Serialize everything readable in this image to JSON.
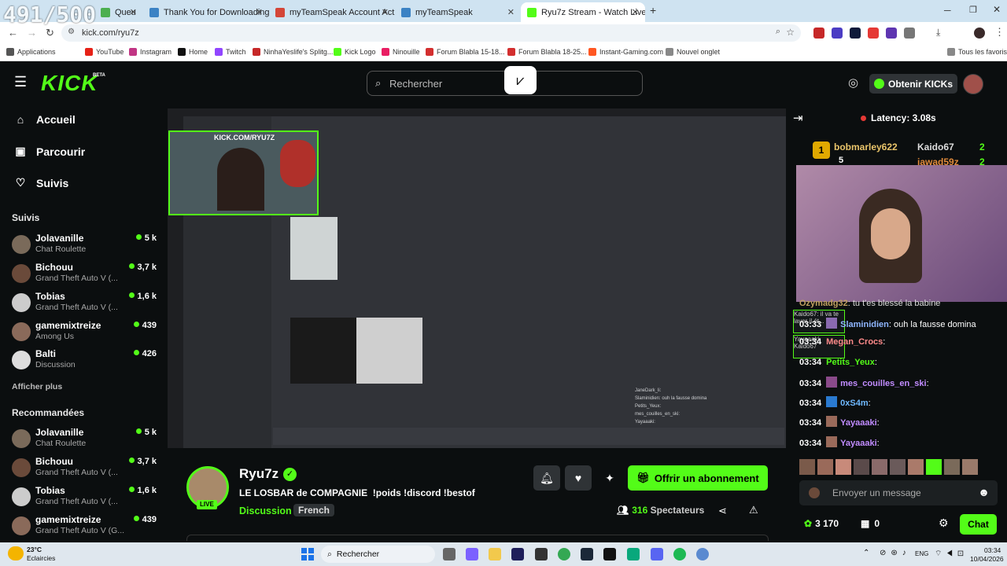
{
  "overlay_counter": "491/500",
  "browser": {
    "tabs": [
      {
        "label": "Queu",
        "color": "#4caf50"
      },
      {
        "label": "Thank You for Downloading Te",
        "color": "#3b82c4"
      },
      {
        "label": "myTeamSpeak Account Activati",
        "color": "#d44638"
      },
      {
        "label": "myTeamSpeak",
        "color": "#3b82c4"
      },
      {
        "label": "Ryu7z Stream - Watch Live",
        "color": "#53fc18"
      }
    ],
    "url": "kick.com/ryu7z",
    "bookmarks": [
      {
        "label": "Applications",
        "color": "#555"
      },
      {
        "label": "YouTube",
        "color": "#e62117"
      },
      {
        "label": "Instagram",
        "color": "#c13584"
      },
      {
        "label": "Home",
        "color": "#111"
      },
      {
        "label": "Twitch",
        "color": "#9146ff"
      },
      {
        "label": "NinhaYeslife's Splitg...",
        "color": "#c62828"
      },
      {
        "label": "Kick Logo",
        "color": "#53fc18"
      },
      {
        "label": "Ninouille",
        "color": "#e91e63"
      },
      {
        "label": "Forum Blabla 15-18...",
        "color": "#d32f2f"
      },
      {
        "label": "Forum Blabla 18-25...",
        "color": "#d32f2f"
      },
      {
        "label": "Instant-Gaming.com",
        "color": "#ff5722"
      },
      {
        "label": "Nouvel onglet",
        "color": "#888"
      },
      {
        "label": "Tous les favoris",
        "color": "#888"
      }
    ]
  },
  "header": {
    "logo": "KICK",
    "logo_badge": "BETA",
    "search_placeholder": "Rechercher",
    "get_kicks": "Obtenir KICKs"
  },
  "sidebar": {
    "nav": [
      {
        "label": "Accueil",
        "icon": "home-icon"
      },
      {
        "label": "Parcourir",
        "icon": "browse-icon"
      },
      {
        "label": "Suivis",
        "icon": "heart-icon"
      }
    ],
    "followed_title": "Suivis",
    "followed": [
      {
        "name": "Jolavanille",
        "game": "Chat Roulette",
        "viewers": "5 k"
      },
      {
        "name": "Bichouu",
        "game": "Grand Theft Auto V (...",
        "viewers": "3,7 k"
      },
      {
        "name": "Tobias",
        "game": "Grand Theft Auto V (...",
        "viewers": "1,6 k"
      },
      {
        "name": "gamemixtreize",
        "game": "Among Us",
        "viewers": "439"
      },
      {
        "name": "Balti",
        "game": "Discussion",
        "viewers": "426"
      }
    ],
    "show_more": "Afficher plus",
    "recommended_title": "Recommandées",
    "recommended": [
      {
        "name": "Jolavanille",
        "game": "Chat Roulette",
        "viewers": "5 k"
      },
      {
        "name": "Bichouu",
        "game": "Grand Theft Auto V (...",
        "viewers": "3,7 k"
      },
      {
        "name": "Tobias",
        "game": "Grand Theft Auto V (...",
        "viewers": "1,6 k"
      },
      {
        "name": "gamemixtreize",
        "game": "Grand Theft Auto V (G...",
        "viewers": "439"
      }
    ]
  },
  "video": {
    "overlay_url": "KICK.COM/RYU7Z",
    "chat_lines": [
      "JaneDark_li:",
      "Slaminidien: ouh la fausse domina",
      "Petits_Yeux:",
      "mes_couilles_en_ski:",
      "Yayaaaki:"
    ]
  },
  "stream": {
    "name": "Ryu7z",
    "live_badge": "LIVE",
    "title": "LE LOSBAR de COMPAGNIE  !poids !discord !bestof",
    "category": "Discussion",
    "language": "French",
    "subscribe": "Offrir un abonnement",
    "viewers": "316",
    "viewers_label": "Spectateurs"
  },
  "chat": {
    "latency": "Latency: 3.08s",
    "top_gifters": [
      {
        "name": "bobmarley622",
        "count": "5"
      },
      {
        "name": "Kaido67",
        "count": "2"
      },
      {
        "name": "jawad59z",
        "count": "2"
      }
    ],
    "messages": [
      {
        "time": "",
        "user": "Ozymadg32",
        "text": ": tu t'es blessé la babine",
        "color": "#c0a060"
      },
      {
        "time": "03:33",
        "user": "Slaminidien",
        "text": ": ouh la fausse domina",
        "color": "#8fb6ff"
      },
      {
        "time": "03:34",
        "user": "Megan_Crocs",
        "text": ":",
        "color": "#ff8a8a"
      },
      {
        "time": "03:34",
        "user": "Petits_Yeux",
        "text": ":",
        "color": "#53fc18"
      },
      {
        "time": "03:34",
        "user": "mes_couilles_en_ski",
        "text": ":",
        "color": "#c18cff"
      },
      {
        "time": "03:34",
        "user": "0xS4m",
        "text": ":",
        "color": "#6fb9ff"
      },
      {
        "time": "03:34",
        "user": "Yayaaaki",
        "text": ":",
        "color": "#c18cff"
      },
      {
        "time": "03:34",
        "user": "Yayaaaki",
        "text": ":",
        "color": "#c18cff"
      }
    ],
    "reply_snippets": [
      "Kaido67: il va te laver il ét...",
      "Yayaaaki",
      "Kaido67"
    ],
    "input_placeholder": "Envoyer un message",
    "points": "3 170",
    "gifts": "0",
    "send": "Chat"
  },
  "taskbar": {
    "weather_temp": "23°C",
    "weather_desc": "Eclaircies",
    "search": "Rechercher",
    "lang": "ENG",
    "time": "03:34",
    "date": "10/04/2026"
  },
  "colors": {
    "accent": "#53fc18",
    "bg": "#0b0e0f"
  }
}
